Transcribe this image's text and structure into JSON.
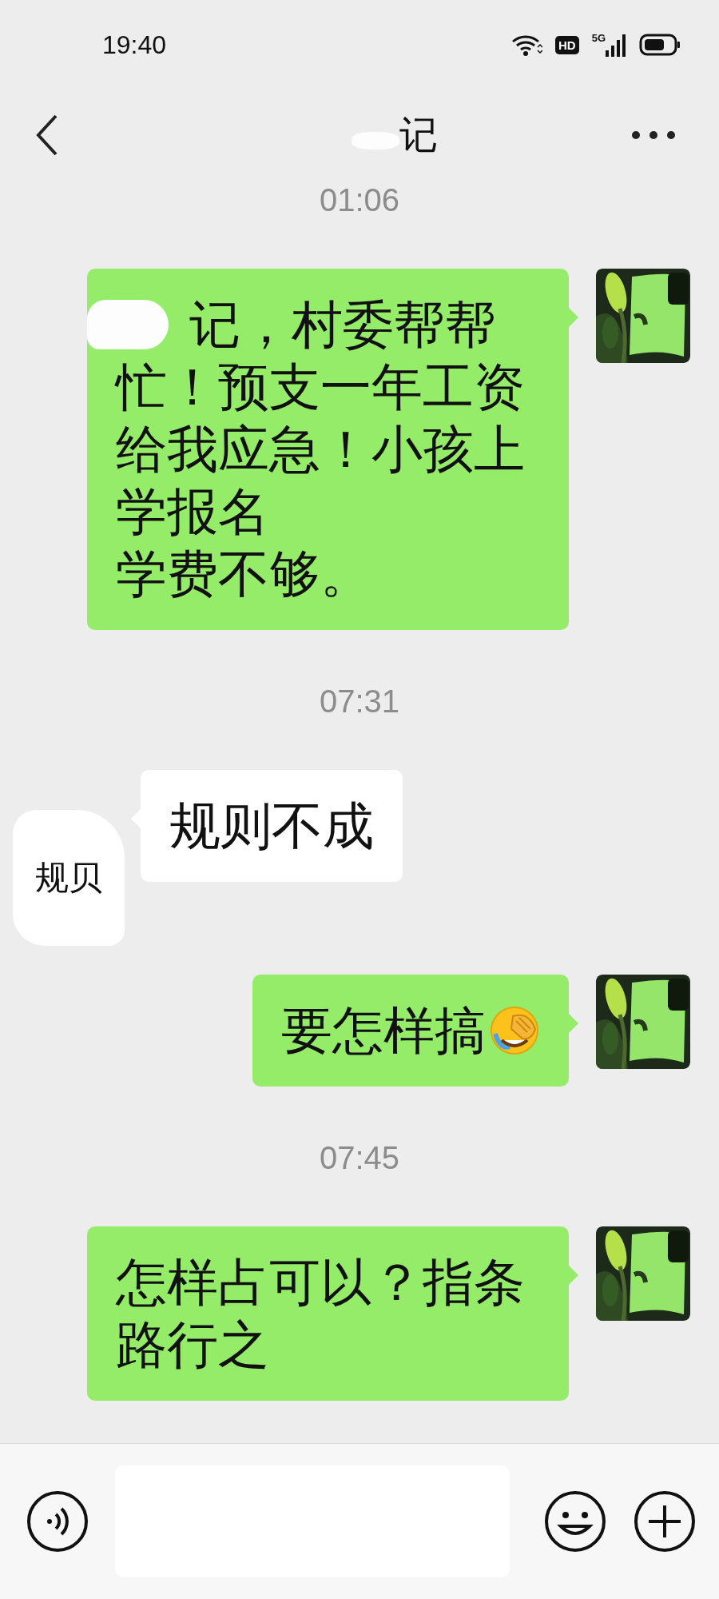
{
  "status_bar": {
    "time": "19:40",
    "hd_badge": "HD",
    "network": "5G"
  },
  "nav_bar": {
    "title": "记",
    "redacted": true
  },
  "messages": [
    {
      "kind": "time",
      "text": "01:06"
    },
    {
      "kind": "sent",
      "lines": [
        "记，村委帮帮",
        "忙！预支一年工资给我应急！小孩上学报名",
        "学费不够。"
      ],
      "redacted": true
    },
    {
      "kind": "time",
      "text": "07:31"
    },
    {
      "kind": "received",
      "text": "规则不成",
      "avatar_text": "规贝"
    },
    {
      "kind": "sent",
      "text": "要怎样搞",
      "emoji_icon": true
    },
    {
      "kind": "time",
      "text": "07:45"
    },
    {
      "kind": "sent",
      "text": "怎样占可以？指条路行之"
    }
  ]
}
